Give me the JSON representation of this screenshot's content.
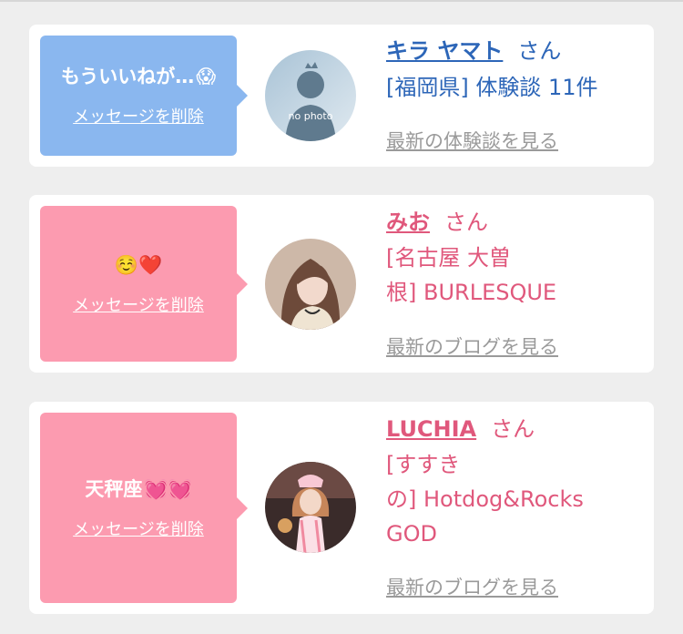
{
  "cards": [
    {
      "message": "もういいねが…",
      "message_emoji": "😱",
      "delete_label": "メッセージを削除",
      "avatar_text": "no photo",
      "name": "キラ ヤマト",
      "suffix": "さん",
      "detail": "[福岡県] 体験談 11件",
      "latest_link": "最新の体験談を見る",
      "theme": "blue"
    },
    {
      "message": "",
      "message_emoji": "☺️❤️",
      "delete_label": "メッセージを削除",
      "name": "みお",
      "suffix": "さん",
      "detail_lines": [
        "[名古屋 大曽",
        "根] BURLESQUE"
      ],
      "latest_link": "最新のブログを見る",
      "theme": "pink"
    },
    {
      "message": "天秤座",
      "message_emoji": "💓💓",
      "delete_label": "メッセージを削除",
      "name": "LUCHIA",
      "suffix": "さん",
      "detail_lines": [
        "[すすき",
        "の] Hotdog&Rocks",
        "GOD"
      ],
      "latest_link": "最新のブログを見る",
      "theme": "pink"
    }
  ],
  "colors": {
    "blue_bubble": "#8ab7ef",
    "pink_bubble": "#fc9bb0",
    "blue_text": "#2d66b8",
    "pink_text": "#e0587c",
    "link_gray": "#9a9a9a"
  }
}
